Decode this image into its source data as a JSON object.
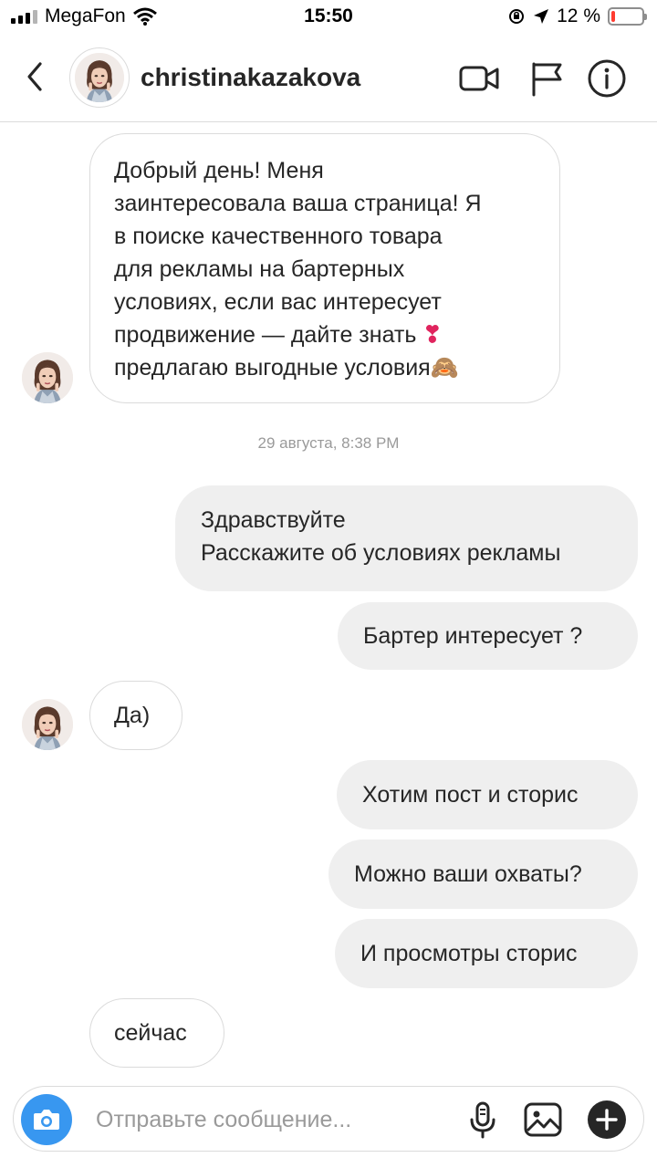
{
  "status_bar": {
    "carrier": "MegaFon",
    "time": "15:50",
    "battery": "12 %"
  },
  "header": {
    "username": "christinakazakova"
  },
  "messages": {
    "m1": {
      "lines": [
        "Добрый день! Меня",
        "заинтересовала ваша страница! Я",
        "в поиске качественного товара",
        "для рекламы на бартерных",
        "условиях, если вас интересует",
        "продвижение — дайте знать",
        "предлагаю выгодные условия"
      ],
      "heart_emoji": "❣",
      "monkey_emoji": "🙈"
    },
    "timestamp": "29 августа, 8:38 PM",
    "m2": {
      "lines": [
        "Здравствуйте",
        "Расскажите об условиях рекламы"
      ]
    },
    "m3": "Бартер интересует ?",
    "m4": "Да)",
    "m5": "Хотим пост и сторис",
    "m6": "Можно ваши охваты?",
    "m7": "И просмотры сторис",
    "m8": "сейчас"
  },
  "composer": {
    "placeholder": "Отправьте сообщение..."
  },
  "colors": {
    "accent": "#3897f0",
    "outgoing_bubble": "#efefef",
    "border": "#dbdbdb",
    "battery_low": "#ff3b30"
  },
  "icons": {
    "back": "chevron-left-icon",
    "video": "video-camera-icon",
    "flag": "flag-icon",
    "info": "info-icon",
    "camera": "camera-icon",
    "mic": "microphone-icon",
    "gallery": "image-icon",
    "plus": "plus-circle-icon"
  }
}
